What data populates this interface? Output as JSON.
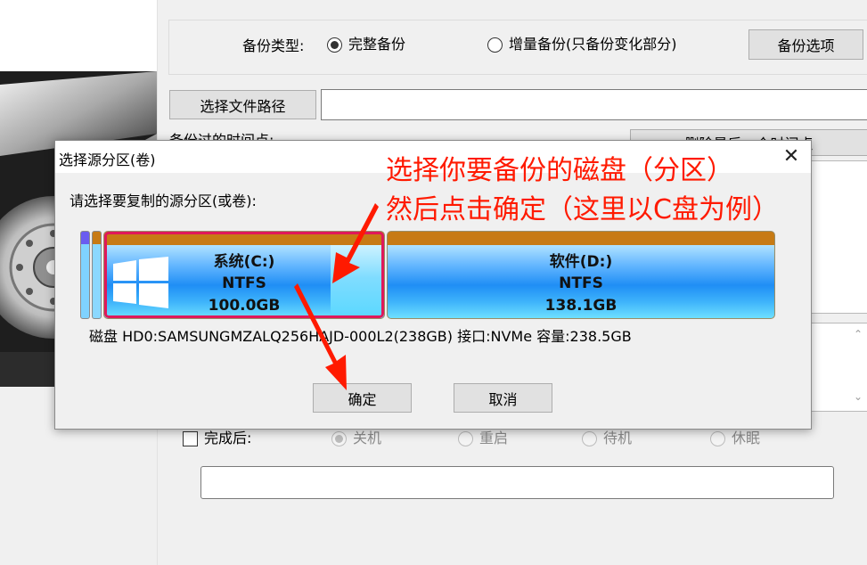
{
  "form": {
    "backup_type_label": "备份类型:",
    "radio_full": "完整备份",
    "radio_incremental": "增量备份(只备份变化部分)",
    "backup_options_button": "备份选项",
    "choose_path_button": "选择文件路径",
    "path_value": "",
    "timepoint_label": "备份过的时间点:",
    "delete_last_button": "删除最后一个时间点",
    "after_done_label": "完成后:",
    "after_options": [
      "关机",
      "重启",
      "待机",
      "休眠"
    ],
    "after_selected": "关机",
    "bottom_field_value": ""
  },
  "dialog": {
    "title": "选择源分区(卷)",
    "close_glyph": "✕",
    "prompt": "请选择要复制的源分区(或卷):",
    "partitions": [
      {
        "name": "系统(C:)",
        "fs": "NTFS",
        "size": "100.0GB",
        "selected": true
      },
      {
        "name": "软件(D:)",
        "fs": "NTFS",
        "size": "138.1GB",
        "selected": false
      }
    ],
    "disk_info": "磁盘 HD0:SAMSUNGMZALQ256HAJD-000L2(238GB)  接口:NVMe  容量:238.5GB",
    "ok_button": "确定",
    "cancel_button": "取消"
  },
  "annotation": {
    "line1": "选择你要备份的磁盘（分区）",
    "line2": "然后点击确定（这里以C盘为例）",
    "color": "#ff1a00"
  },
  "icons": {
    "windows_logo": "windows-logo-icon",
    "hdd_art": "hard-drive-illustration"
  },
  "colors": {
    "selection_border": "#e0185a",
    "partition_header": "#c77a14",
    "partition_blue": "#1f8ef5"
  }
}
